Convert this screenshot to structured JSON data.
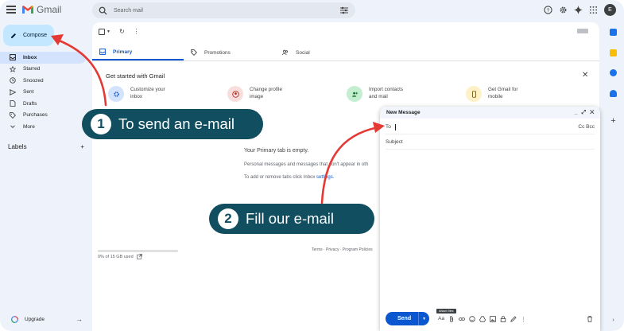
{
  "app": {
    "name": "Gmail"
  },
  "search": {
    "placeholder": "Search mail"
  },
  "user": {
    "avatar_letter": "E"
  },
  "sidebar": {
    "compose_label": "Compose",
    "items": [
      {
        "label": "Inbox",
        "icon": "inbox-icon",
        "active": true
      },
      {
        "label": "Starred",
        "icon": "star-icon"
      },
      {
        "label": "Snoozed",
        "icon": "clock-icon"
      },
      {
        "label": "Sent",
        "icon": "send-icon"
      },
      {
        "label": "Drafts",
        "icon": "draft-icon"
      },
      {
        "label": "Purchases",
        "icon": "tag-icon"
      },
      {
        "label": "More",
        "icon": "chevron-down-icon"
      }
    ],
    "labels_heading": "Labels",
    "labels_add": "+",
    "upgrade_label": "Upgrade"
  },
  "tabs": [
    {
      "label": "Primary",
      "icon": "inbox-icon",
      "active": true
    },
    {
      "label": "Promotions",
      "icon": "tag-icon"
    },
    {
      "label": "Social",
      "icon": "people-icon"
    }
  ],
  "get_started": {
    "title": "Get started with Gmail",
    "cards": [
      {
        "line1": "Customize your",
        "line2": "inbox",
        "icon": "gear-icon",
        "color": "#d3e3fd"
      },
      {
        "line1": "Change profile",
        "line2": "image",
        "icon": "person-icon",
        "color": "#f9dede"
      },
      {
        "line1": "Import contacts",
        "line2": "and mail",
        "icon": "person-add-icon",
        "color": "#c4eed0"
      },
      {
        "line1": "Get Gmail for",
        "line2": "mobile",
        "icon": "phone-icon",
        "color": "#fef1c7"
      }
    ]
  },
  "empty_state": {
    "line1": "Your Primary tab is empty.",
    "line2": "Personal messages and messages that don't appear in oth",
    "line3_prefix": "To add or remove tabs click Inbox ",
    "line3_link": "settings."
  },
  "storage": {
    "text": "0% of 15 GB used",
    "used_fraction": 0.0
  },
  "footer": {
    "links": "Terms · Privacy · Program Policies"
  },
  "composer": {
    "title": "New Message",
    "controls": "_ ⤢ ✕",
    "to_label": "To",
    "cc_bcc": "Cc Bcc",
    "subject_label": "Subject",
    "send_label": "Send",
    "format_label": "Aa",
    "tooltip": "Attach files"
  },
  "callouts": [
    {
      "number": "1",
      "text": "To send an e-mail"
    },
    {
      "number": "2",
      "text": "Fill our e-mail"
    }
  ],
  "colors": {
    "callout_bg": "#114e60",
    "arrow": "#e53935",
    "accent": "#0b57d0",
    "compose_bg": "#c2e7ff"
  }
}
